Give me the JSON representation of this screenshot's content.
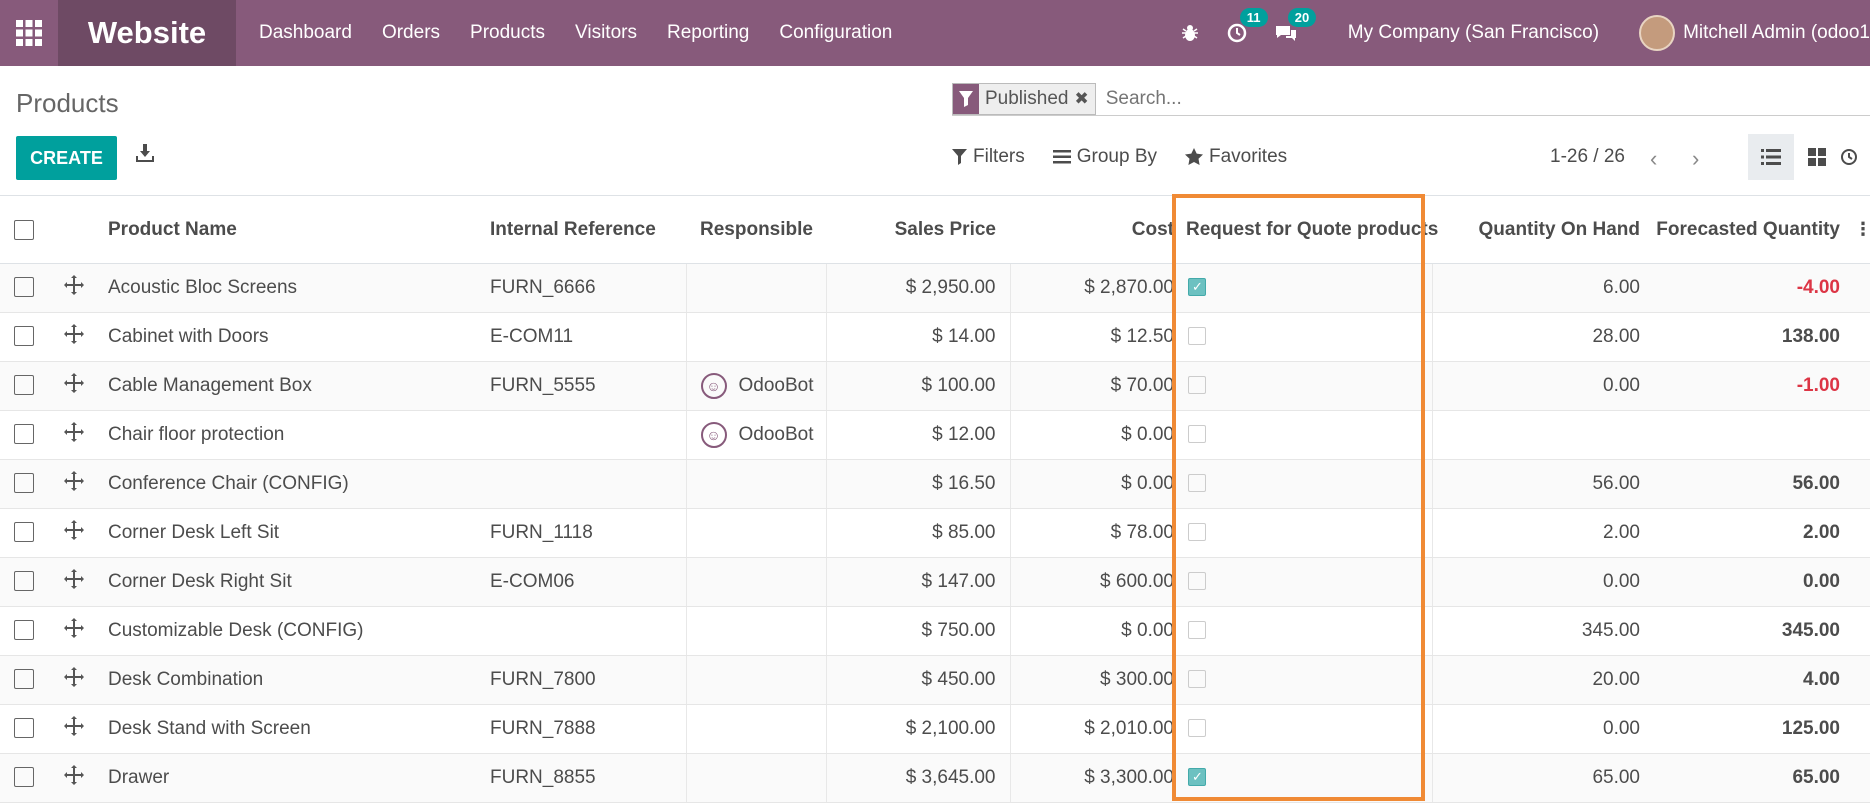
{
  "app": {
    "brand": "Website",
    "menu": [
      "Dashboard",
      "Orders",
      "Products",
      "Visitors",
      "Reporting",
      "Configuration"
    ],
    "activity_count": "11",
    "messages_count": "20",
    "company": "My Company (San Francisco)",
    "user": "Mitchell Admin (odoo1"
  },
  "control": {
    "title": "Products",
    "facet": "Published",
    "search_placeholder": "Search...",
    "create_label": "CREATE",
    "filters_label": "Filters",
    "groupby_label": "Group By",
    "favorites_label": "Favorites",
    "pager": "1-26 / 26"
  },
  "table": {
    "headers": {
      "name": "Product Name",
      "ref": "Internal Reference",
      "resp": "Responsible",
      "price": "Sales Price",
      "cost": "Cost",
      "rfq": "Request for Quote products",
      "qoh": "Quantity On Hand",
      "forecast": "Forecasted Quantity"
    },
    "rows": [
      {
        "name": "Acoustic Bloc Screens",
        "ref": "FURN_6666",
        "resp": "",
        "price": "$ 2,950.00",
        "cost": "$ 2,870.00",
        "rfq": true,
        "qoh": "6.00",
        "forecast": "-4.00",
        "neg": true
      },
      {
        "name": "Cabinet with Doors",
        "ref": "E-COM11",
        "resp": "",
        "price": "$ 14.00",
        "cost": "$ 12.50",
        "rfq": false,
        "qoh": "28.00",
        "forecast": "138.00",
        "neg": false
      },
      {
        "name": "Cable Management Box",
        "ref": "FURN_5555",
        "resp": "OdooBot",
        "price": "$ 100.00",
        "cost": "$ 70.00",
        "rfq": false,
        "qoh": "0.00",
        "forecast": "-1.00",
        "neg": true
      },
      {
        "name": "Chair floor protection",
        "ref": "",
        "resp": "OdooBot",
        "price": "$ 12.00",
        "cost": "$ 0.00",
        "rfq": false,
        "qoh": "",
        "forecast": "",
        "neg": false
      },
      {
        "name": "Conference Chair (CONFIG)",
        "ref": "",
        "resp": "",
        "price": "$ 16.50",
        "cost": "$ 0.00",
        "rfq": false,
        "qoh": "56.00",
        "forecast": "56.00",
        "neg": false
      },
      {
        "name": "Corner Desk Left Sit",
        "ref": "FURN_1118",
        "resp": "",
        "price": "$ 85.00",
        "cost": "$ 78.00",
        "rfq": false,
        "qoh": "2.00",
        "forecast": "2.00",
        "neg": false
      },
      {
        "name": "Corner Desk Right Sit",
        "ref": "E-COM06",
        "resp": "",
        "price": "$ 147.00",
        "cost": "$ 600.00",
        "rfq": false,
        "qoh": "0.00",
        "forecast": "0.00",
        "neg": false
      },
      {
        "name": "Customizable Desk (CONFIG)",
        "ref": "",
        "resp": "",
        "price": "$ 750.00",
        "cost": "$ 0.00",
        "rfq": false,
        "qoh": "345.00",
        "forecast": "345.00",
        "neg": false
      },
      {
        "name": "Desk Combination",
        "ref": "FURN_7800",
        "resp": "",
        "price": "$ 450.00",
        "cost": "$ 300.00",
        "rfq": false,
        "qoh": "20.00",
        "forecast": "4.00",
        "neg": false
      },
      {
        "name": "Desk Stand with Screen",
        "ref": "FURN_7888",
        "resp": "",
        "price": "$ 2,100.00",
        "cost": "$ 2,010.00",
        "rfq": false,
        "qoh": "0.00",
        "forecast": "125.00",
        "neg": false
      },
      {
        "name": "Drawer",
        "ref": "FURN_8855",
        "resp": "",
        "price": "$ 3,645.00",
        "cost": "$ 3,300.00",
        "rfq": true,
        "qoh": "65.00",
        "forecast": "65.00",
        "neg": false
      }
    ]
  },
  "colors": {
    "primary": "#875a7b",
    "accent": "#00a09d",
    "highlight": "#f08a35",
    "negative": "#dc3545"
  }
}
